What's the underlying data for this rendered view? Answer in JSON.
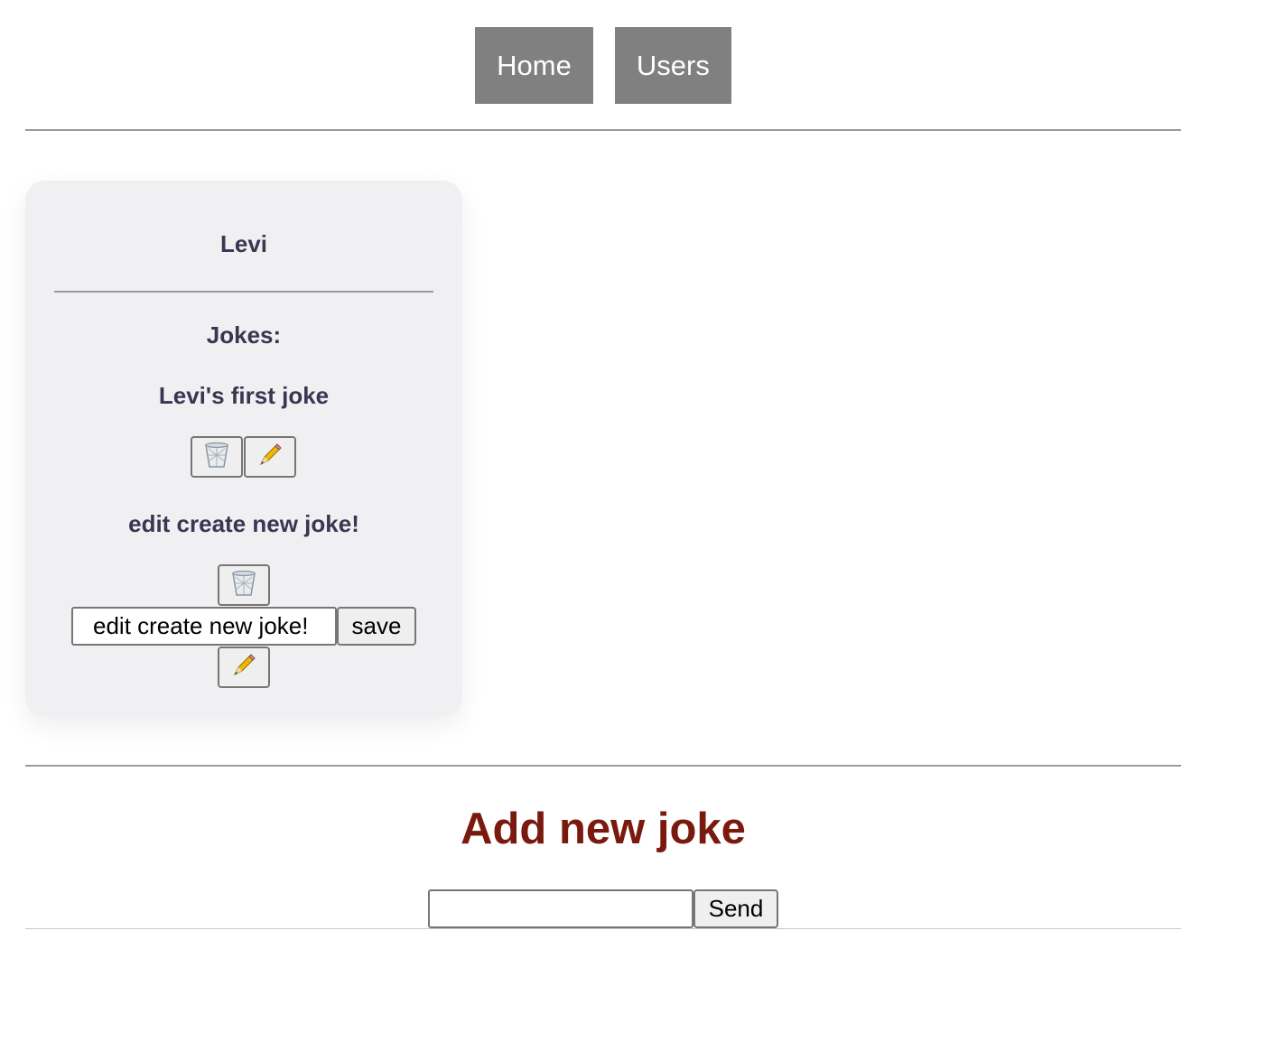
{
  "nav": {
    "home_label": "Home",
    "users_label": "Users"
  },
  "user_card": {
    "name": "Levi",
    "jokes_heading": "Jokes:",
    "jokes": [
      {
        "text": "Levi's first joke"
      },
      {
        "text": "edit create new joke!",
        "edit_value": "edit create new joke!",
        "save_label": "save"
      }
    ]
  },
  "add_joke": {
    "title": "Add new joke",
    "input_value": "",
    "send_label": "Send"
  },
  "colors": {
    "nav_bg": "#808080",
    "card_bg": "#f0f0f2",
    "card_text": "#3a3652",
    "title_red": "#7a1a0e"
  }
}
